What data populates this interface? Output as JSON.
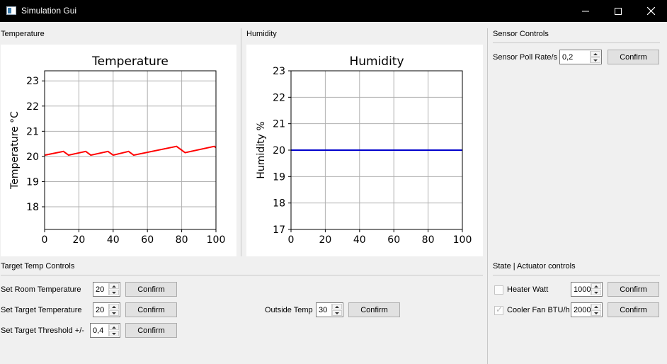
{
  "window": {
    "title": "Simulation Gui"
  },
  "sections": {
    "temperature": "Temperature",
    "humidity": "Humidity",
    "sensor_controls": "Sensor Controls",
    "target_temp_controls": "Target Temp Controls",
    "state_actuator": "State | Actuator controls"
  },
  "sensor": {
    "poll_rate_label": "Sensor Poll Rate/s",
    "poll_rate_value": "0,2",
    "confirm": "Confirm"
  },
  "target": {
    "room_label": "Set Room Temperature",
    "room_value": "20",
    "target_label": "Set Target Temperature",
    "target_value": "20",
    "threshold_label": "Set Target Threshold +/-",
    "threshold_value": "0,4",
    "outside_label": "Outside Temp",
    "outside_value": "30",
    "confirm": "Confirm"
  },
  "actuators": {
    "heater_label": "Heater Watt",
    "heater_value": "1000",
    "heater_checked": false,
    "cooler_label": "Cooler Fan BTU/h",
    "cooler_value": "2000",
    "cooler_checked": true,
    "confirm": "Confirm"
  },
  "icons": {
    "app": "app-window-icon",
    "minimize": "minimize-icon",
    "maximize": "maximize-icon",
    "close": "close-icon"
  },
  "chart_data": [
    {
      "type": "line",
      "title": "Temperature",
      "xlabel": "",
      "ylabel": "Temperature °C",
      "xlim": [
        0,
        100
      ],
      "ylim": [
        17.1,
        23.4
      ],
      "xticks": [
        0,
        20,
        40,
        60,
        80,
        100
      ],
      "yticks": [
        18,
        19,
        20,
        21,
        22,
        23
      ],
      "grid": true,
      "series": [
        {
          "color": "#ff0000",
          "x": [
            0,
            11,
            14,
            24,
            27,
            37,
            40,
            49,
            52,
            77,
            82,
            99,
            100
          ],
          "y": [
            20.05,
            20.2,
            20.05,
            20.2,
            20.05,
            20.2,
            20.05,
            20.2,
            20.05,
            20.4,
            20.15,
            20.4,
            20.35
          ]
        }
      ]
    },
    {
      "type": "line",
      "title": "Humidity",
      "xlabel": "",
      "ylabel": "Humidity %",
      "xlim": [
        0,
        100
      ],
      "ylim": [
        17,
        23
      ],
      "xticks": [
        0,
        20,
        40,
        60,
        80,
        100
      ],
      "yticks": [
        17,
        18,
        19,
        20,
        21,
        22,
        23
      ],
      "grid": true,
      "series": [
        {
          "color": "#0000cc",
          "x": [
            0,
            100
          ],
          "y": [
            20,
            20
          ]
        }
      ]
    }
  ]
}
